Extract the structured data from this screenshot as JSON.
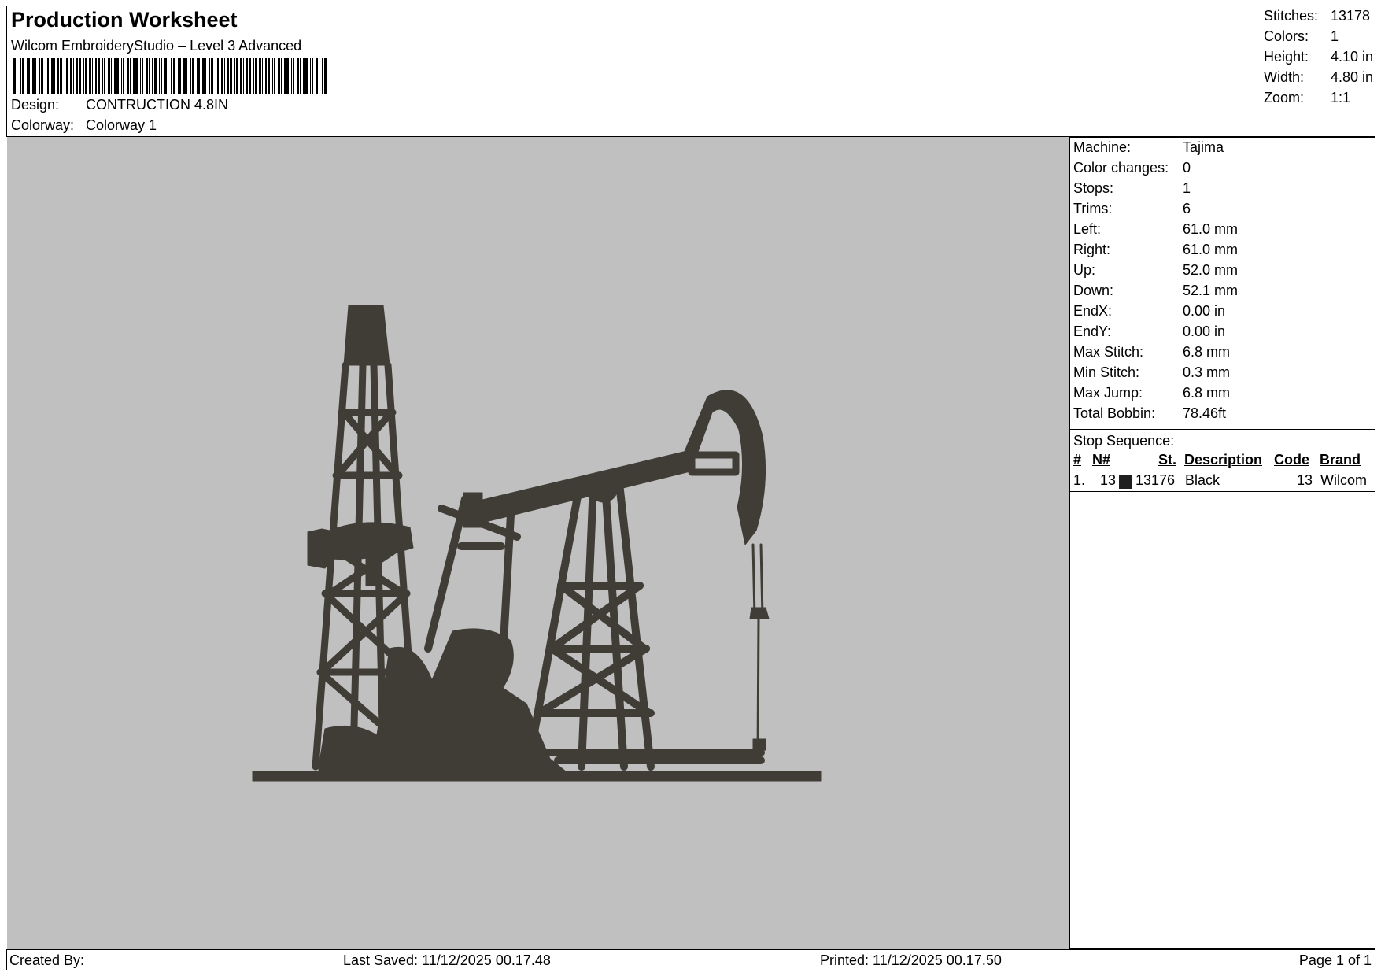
{
  "header": {
    "title": "Production Worksheet",
    "subtitle": "Wilcom EmbroideryStudio – Level 3 Advanced",
    "design_label": "Design:",
    "design_value": "CONTRUCTION 4.8IN",
    "colorway_label": "Colorway:",
    "colorway_value": "Colorway 1"
  },
  "summary": [
    {
      "label": "Stitches:",
      "value": "13178"
    },
    {
      "label": "Colors:",
      "value": "1"
    },
    {
      "label": "Height:",
      "value": "4.10 in"
    },
    {
      "label": "Width:",
      "value": "4.80 in"
    },
    {
      "label": "Zoom:",
      "value": "1:1"
    }
  ],
  "details": [
    {
      "label": "Machine:",
      "value": "Tajima"
    },
    {
      "label": "Color changes:",
      "value": "0"
    },
    {
      "label": "Stops:",
      "value": "1"
    },
    {
      "label": "Trims:",
      "value": "6"
    },
    {
      "label": "Left:",
      "value": "61.0 mm"
    },
    {
      "label": "Right:",
      "value": "61.0 mm"
    },
    {
      "label": "Up:",
      "value": "52.0 mm"
    },
    {
      "label": "Down:",
      "value": "52.1 mm"
    },
    {
      "label": "EndX:",
      "value": "0.00 in"
    },
    {
      "label": "EndY:",
      "value": "0.00 in"
    },
    {
      "label": "Max Stitch:",
      "value": "6.8 mm"
    },
    {
      "label": "Min Stitch:",
      "value": "0.3 mm"
    },
    {
      "label": "Max Jump:",
      "value": "6.8 mm"
    },
    {
      "label": "Total Bobbin:",
      "value": "78.46ft"
    }
  ],
  "stop_sequence": {
    "title": "Stop Sequence:",
    "headers": {
      "index": "#",
      "needle": "N#",
      "stitches": "St.",
      "description": "Description",
      "code": "Code",
      "brand": "Brand"
    },
    "rows": [
      {
        "index": "1.",
        "needle": "13",
        "stitches": "13176",
        "description": "Black",
        "code": "13",
        "brand": "Wilcom",
        "color": "#1f1f1f"
      }
    ]
  },
  "colors": {
    "canvas_bg": "#c0c0c0",
    "thread": "#3f3d36"
  },
  "footer": {
    "created_by": "Created By:",
    "last_saved": "Last Saved: 11/12/2025 00.17.48",
    "printed": "Printed: 11/12/2025 00.17.50",
    "page": "Page 1 of 1"
  }
}
